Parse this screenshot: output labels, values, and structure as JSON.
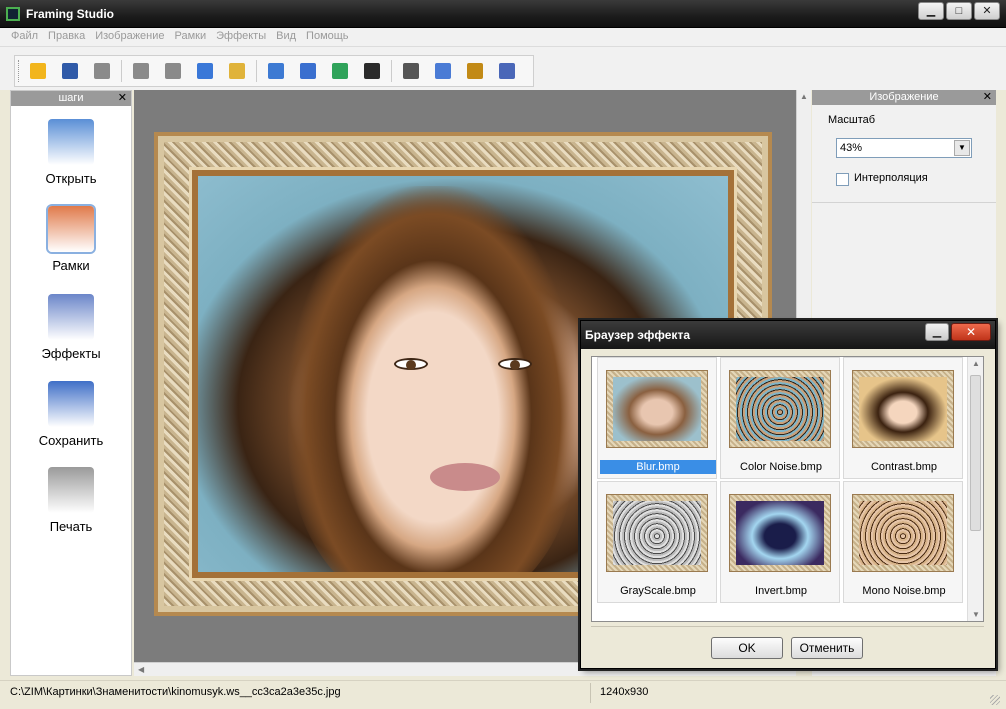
{
  "window": {
    "title": "Framing Studio",
    "buttons": [
      "▁",
      "□",
      "✕"
    ]
  },
  "menu": [
    "Файл",
    "Правка",
    "Изображение",
    "Рамки",
    "Эффекты",
    "Вид",
    "Помощь"
  ],
  "toolbar": {
    "icons": [
      "open-icon",
      "save-icon",
      "print-icon",
      "undo-icon",
      "redo-icon",
      "copy-icon",
      "paste-icon",
      "image-icon",
      "frame-icon",
      "picture-icon",
      "border-icon",
      "crop-icon",
      "rotate-icon",
      "text-icon",
      "properties-icon"
    ],
    "colors": [
      "#f2b51c",
      "#2f5aa8",
      "#8a8a8a",
      "#8a8a8a",
      "#8a8a8a",
      "#3a78d8",
      "#e0b33a",
      "#3d7ad3",
      "#3a6fcf",
      "#2fa35a",
      "#2b2b2b",
      "#555555",
      "#4a7bd5",
      "#c28a16",
      "#4a67b8"
    ]
  },
  "steps_panel": {
    "title": "шаги",
    "close": "✕",
    "items": [
      {
        "label": "Открыть",
        "icon": "folder-icon",
        "color": "#5a8fd6"
      },
      {
        "label": "Рамки",
        "icon": "frames-icon",
        "color": "#e07a4a"
      },
      {
        "label": "Эффекты",
        "icon": "effects-icon",
        "color": "#6b86c9"
      },
      {
        "label": "Сохранить",
        "icon": "floppy-icon",
        "color": "#3f6fc7"
      },
      {
        "label": "Печать",
        "icon": "printer-icon",
        "color": "#9a9a9a"
      }
    ]
  },
  "image_panel": {
    "title": "Изображение",
    "close": "✕",
    "scale_label": "Масштаб",
    "scale_value": "43%",
    "interpolation_label": "Интерполяция",
    "interpolation_checked": false
  },
  "status": {
    "path": "C:\\ZIM\\Картинки\\Знаменитости\\kinomusyk.ws__cc3ca2a3e35c.jpg",
    "dimensions": "1240x930"
  },
  "effect_dialog": {
    "title": "Браузер эффекта",
    "minimize": "▁",
    "close": "✕",
    "effects": [
      {
        "name": "Blur.bmp",
        "selected": true,
        "tone": "blur"
      },
      {
        "name": "Color Noise.bmp",
        "selected": false,
        "tone": "colornoise"
      },
      {
        "name": "Contrast.bmp",
        "selected": false,
        "tone": "contrast"
      },
      {
        "name": "GrayScale.bmp",
        "selected": false,
        "tone": "gray"
      },
      {
        "name": "Invert.bmp",
        "selected": false,
        "tone": "invert"
      },
      {
        "name": "Mono Noise.bmp",
        "selected": false,
        "tone": "mononoise"
      }
    ],
    "ok_label": "OK",
    "cancel_label": "Отменить"
  }
}
